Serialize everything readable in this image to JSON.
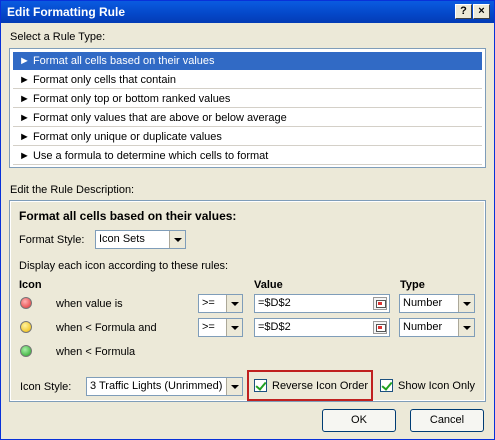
{
  "window": {
    "title": "Edit Formatting Rule",
    "help_label": "?",
    "close_label": "×"
  },
  "rule_type": {
    "label": "Select a Rule Type:",
    "items": [
      {
        "label": "► Format all cells based on their values"
      },
      {
        "label": "► Format only cells that contain"
      },
      {
        "label": "► Format only top or bottom ranked values"
      },
      {
        "label": "► Format only values that are above or below average"
      },
      {
        "label": "► Format only unique or duplicate values"
      },
      {
        "label": "► Use a formula to determine which cells to format"
      }
    ]
  },
  "description": {
    "label": "Edit the Rule Description:",
    "heading": "Format all cells based on their values:",
    "format_style_label": "Format Style:",
    "format_style_value": "Icon Sets",
    "display_text": "Display each icon according to these rules:",
    "col_icon": "Icon",
    "col_value": "Value",
    "col_type": "Type",
    "rows": [
      {
        "icon": "red-circle-icon",
        "condition": "when value is",
        "operator": ">=",
        "value": "=$D$2",
        "type": "Number"
      },
      {
        "icon": "yellow-circle-icon",
        "condition": "when < Formula and",
        "operator": ">=",
        "value": "=$D$2",
        "type": "Number"
      },
      {
        "icon": "green-circle-icon",
        "condition": "when < Formula"
      }
    ],
    "icon_style_label": "Icon Style:",
    "icon_style_value": "3 Traffic Lights (Unrimmed)",
    "reverse_label": "Reverse Icon Order",
    "reverse_checked": true,
    "show_icon_only_label": "Show Icon Only",
    "show_icon_only_checked": true
  },
  "buttons": {
    "ok": "OK",
    "cancel": "Cancel"
  },
  "colors": {
    "title_bar": "#0a5be0",
    "selection": "#316ac5",
    "highlight": "#c0201f"
  }
}
